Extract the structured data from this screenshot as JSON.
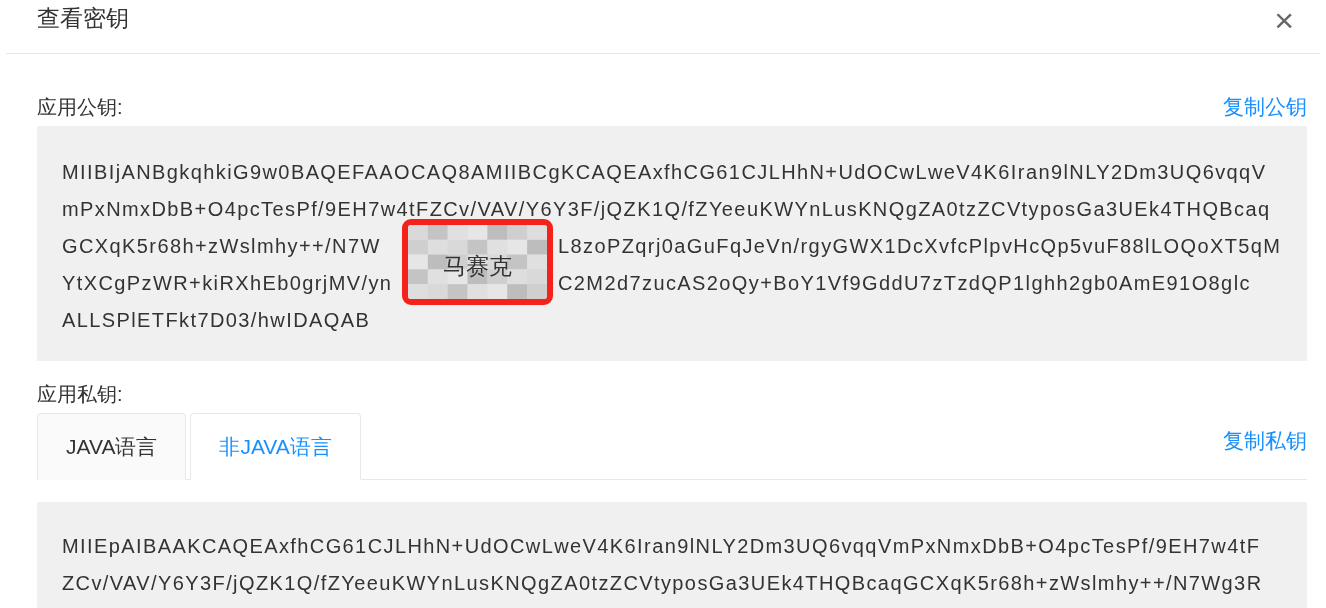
{
  "dialog": {
    "title": "查看密钥",
    "close": "×"
  },
  "public_key": {
    "label": "应用公钥:",
    "copy": "复制公钥",
    "lines": [
      {
        "parts": [
          "MIIBIjANBgkqhkiG9w0BAQEFAAOCAQ8AMIIBCgKCAQEAxfhCG61CJLHhN+UdOCwLweV4K6Iran9lNLY2Dm3UQ6vqqV"
        ]
      },
      {
        "parts": [
          "mPxNmxDbB+O4pcTesPf/9EH7w4tFZCv/VAV/Y6Y3F/jQZK1Q/fZYeeuKWYnLusKNQgZA0tzZCVtyposGa3UEk4THQBcaq"
        ]
      },
      {
        "parts": [
          "GCXqK5r68h+zWslmhy++/N7W",
          "L8zoPZqrj0aGuFqJeVn/rgyGWX1DcXvfcPlpvHcQp5vuF88lLOQoXT5qM"
        ]
      },
      {
        "parts": [
          "YtXCgPzWR+kiRXhEb0grjMV/yn",
          "C2M2d7zucAS2oQy+BoY1Vf9GddU7zTzdQP1lghh2gb0AmE91O8glc"
        ]
      },
      {
        "parts": [
          "ALLSPlETFkt7D03/hwIDAQAB"
        ]
      }
    ],
    "mosaic": {
      "label": "马赛克"
    }
  },
  "private_key": {
    "label": "应用私钥:",
    "copy": "复制私钥",
    "tabs": [
      {
        "label": "JAVA语言",
        "selected": false
      },
      {
        "label": "非JAVA语言",
        "selected": true
      }
    ],
    "lines": [
      {
        "parts": [
          "MIIEpAIBAAKCAQEAxfhCG61CJLHhN+UdOCwLweV4K6Iran9lNLY2Dm3UQ6vqqVmPxNmxDbB+O4pcTesPf/9EH7w4tF"
        ]
      },
      {
        "parts": [
          "ZCv/VAV/Y6Y3F/jQZK1Q/fZYeeuKWYnLusKNQgZA0tzZCVtyposGa3UEk4THQBcaqGCXqK5r68h+zWslmhy++/N7Wg3R"
        ]
      }
    ]
  }
}
